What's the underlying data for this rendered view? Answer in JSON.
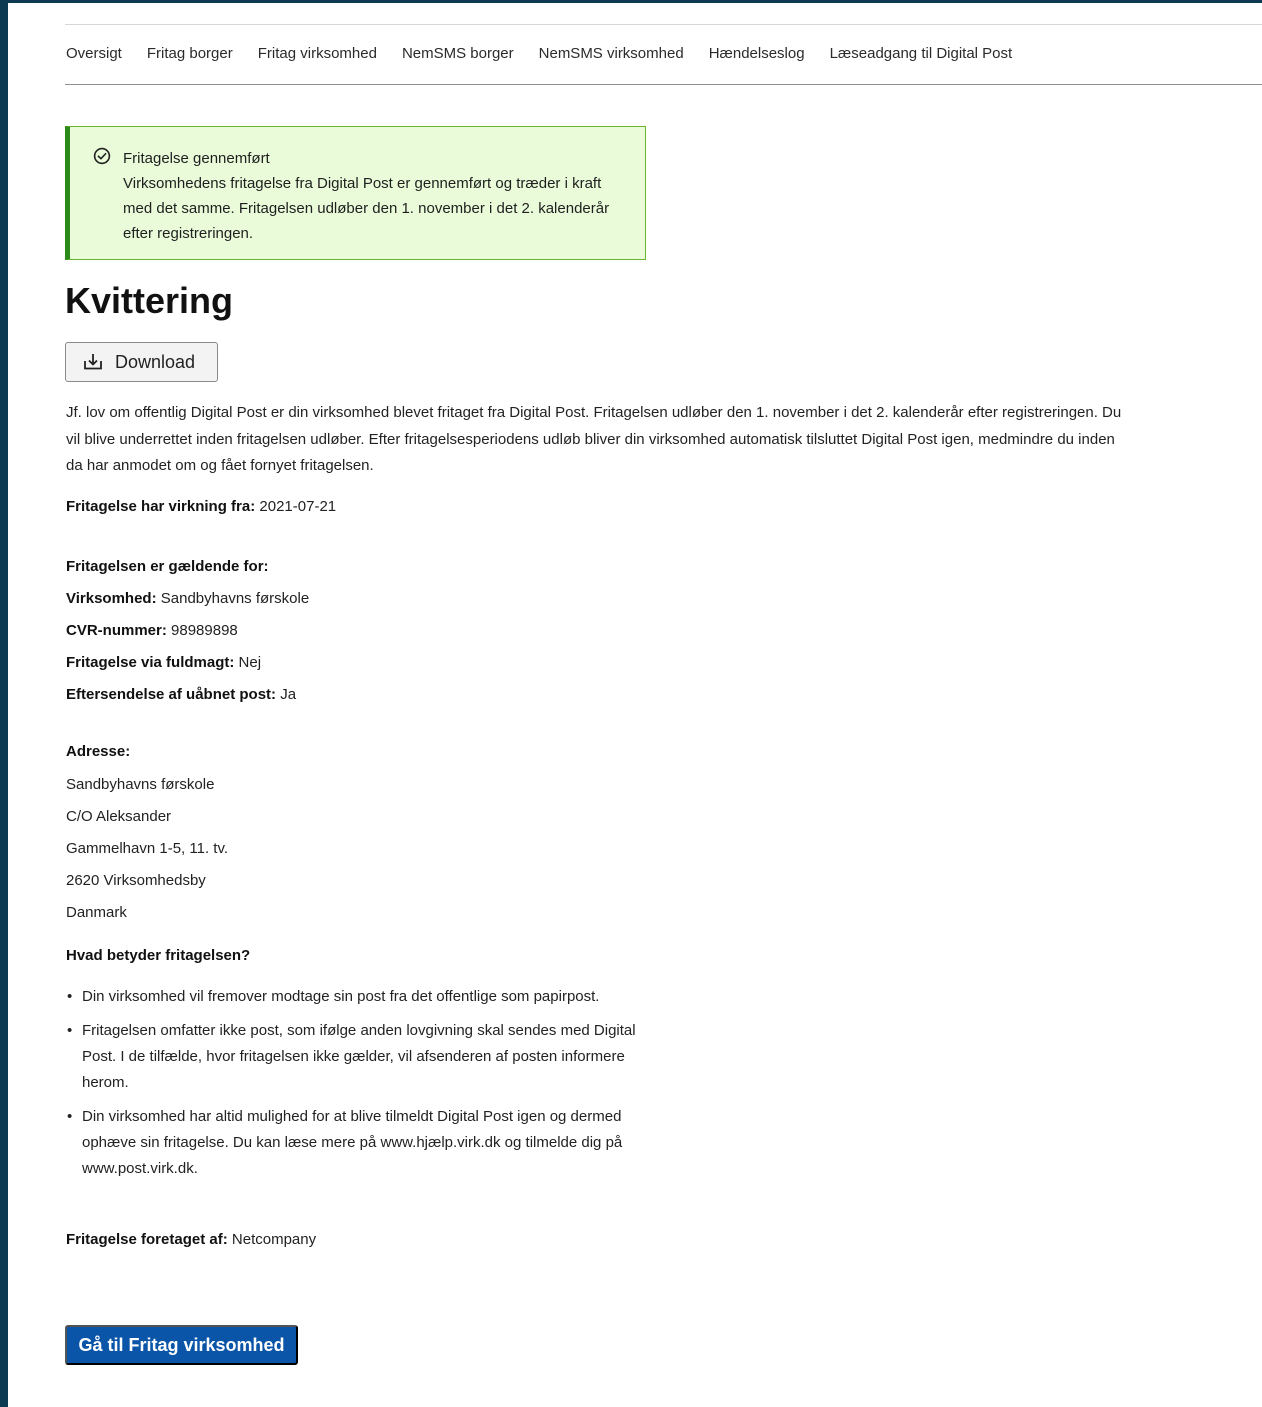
{
  "nav": {
    "items": [
      "Oversigt",
      "Fritag borger",
      "Fritag virksomhed",
      "NemSMS borger",
      "NemSMS virksomhed",
      "Hændelseslog",
      "Læseadgang til Digital Post"
    ]
  },
  "alert": {
    "icon": "check-circle-icon",
    "title": "Fritagelse gennemført",
    "body": "Virksomhedens fritagelse fra Digital Post er gennemført og træder i kraft med det samme. Fritagelsen udløber den 1. november i det 2. kalenderår efter registreringen.",
    "colors": {
      "background": "#eafbd9",
      "border": "#2c8a18"
    }
  },
  "page_title": "Kvittering",
  "download": {
    "label": "Download",
    "icon": "download-icon"
  },
  "intro": "Jf. lov om offentlig Digital Post er din virksomhed blevet fritaget fra Digital Post. Fritagelsen udløber den 1. november i det 2. kalenderår efter registreringen. Du vil blive underrettet inden fritagelsen udløber. Efter fritagelsesperiodens udløb bliver din virksomhed automatisk tilsluttet Digital Post igen, medmindre du inden da har anmodet om og fået fornyet fritagelsen.",
  "effective": {
    "label": "Fritagelse har virkning fra:",
    "value": "2021-07-21"
  },
  "applies_heading": "Fritagelsen er gældende for:",
  "details": {
    "company": {
      "label": "Virksomhed:",
      "value": "Sandbyhavns førskole"
    },
    "cvr": {
      "label": "CVR-nummer:",
      "value": "98989898"
    },
    "power_of_attorney": {
      "label": "Fritagelse via fuldmagt:",
      "value": "Nej"
    },
    "forwarding": {
      "label": "Eftersendelse af uåbnet post:",
      "value": "Ja"
    }
  },
  "address": {
    "heading": "Adresse:",
    "lines": [
      "Sandbyhavns førskole",
      "C/O Aleksander",
      "Gammelhavn 1-5, 11. tv.",
      "2620 Virksomhedsby",
      "Danmark"
    ]
  },
  "meaning": {
    "heading": "Hvad betyder fritagelsen?",
    "bullets": [
      "Din virksomhed vil fremover modtage sin post fra det offentlige som papirpost.",
      "Fritagelsen omfatter ikke post, som ifølge anden lovgivning skal sendes med Digital Post. I de tilfælde, hvor fritagelsen ikke gælder, vil afsenderen af posten informere herom.",
      "Din virksomhed har altid mulighed for at blive tilmeldt Digital Post igen og dermed ophæve sin fritagelse. Du kan læse mere på www.hjælp.virk.dk og tilmelde dig på www.post.virk.dk."
    ]
  },
  "performed_by": {
    "label": "Fritagelse foretaget af:",
    "value": "Netcompany"
  },
  "goto_button": {
    "label": "Gå til Fritag virksomhed",
    "color": "#0a55a8"
  }
}
